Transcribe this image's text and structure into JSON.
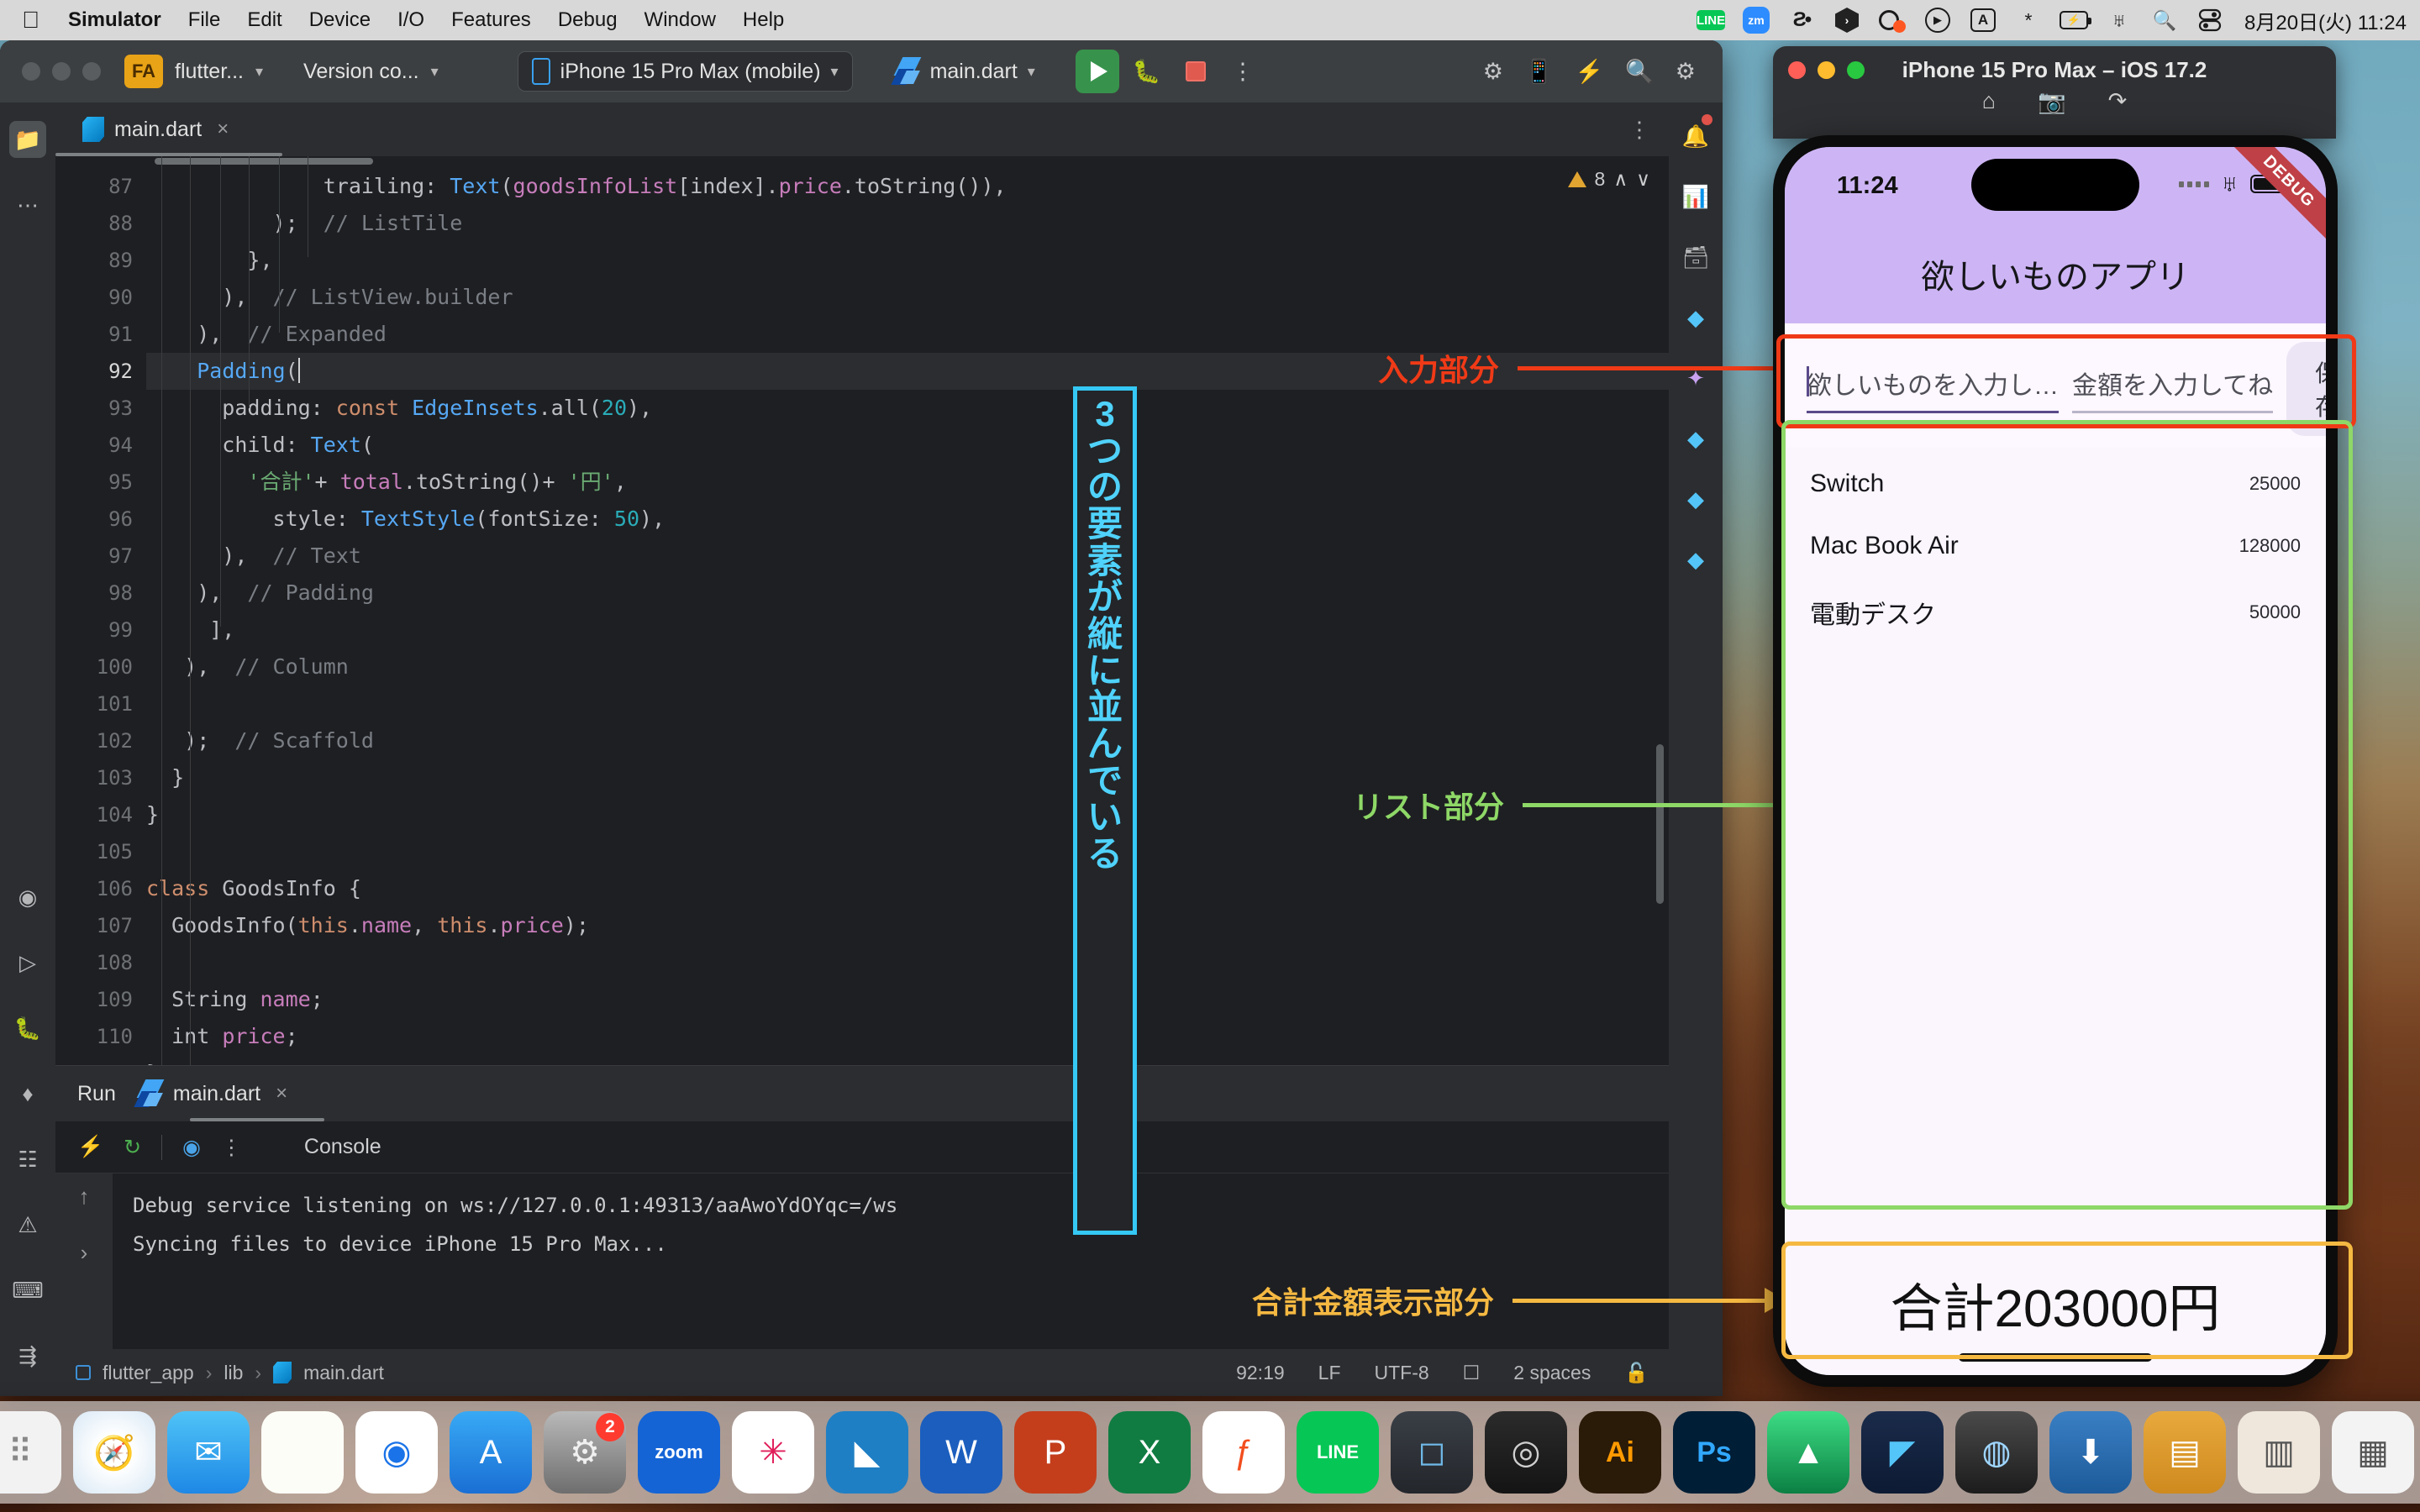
{
  "menubar": {
    "apple_icon": "apple-logo-icon",
    "items": [
      {
        "label": "Simulator",
        "bold": true
      },
      {
        "label": "File",
        "bold": false
      },
      {
        "label": "Edit",
        "bold": false
      },
      {
        "label": "Device",
        "bold": false
      },
      {
        "label": "I/O",
        "bold": false
      },
      {
        "label": "Features",
        "bold": false
      },
      {
        "label": "Debug",
        "bold": false
      },
      {
        "label": "Window",
        "bold": false
      },
      {
        "label": "Help",
        "bold": false
      }
    ],
    "status_icons": [
      "line-icon",
      "zoom-icon",
      "figma-icon",
      "hex-app-icon",
      "screen-recorder-icon",
      "play-circle-icon",
      "input-source-icon",
      "bluetooth-icon",
      "battery-charging-icon",
      "wifi-icon",
      "spotlight-search-icon",
      "control-center-icon"
    ],
    "input_source": "A",
    "clock": "8月20日(火)  11:24"
  },
  "ide": {
    "project_badge": "FA",
    "project_name": "flutter...",
    "vcs_label": "Version co...",
    "device_selector": "iPhone 15 Pro Max (mobile)",
    "run_config": "main.dart",
    "toolbar_icons": [
      "run-button",
      "debug-button",
      "stop-button",
      "more-options-icon",
      "flutter-inspector-icon",
      "device-preview-icon",
      "hot-reload-icon",
      "search-everywhere-icon",
      "settings-gear-icon"
    ],
    "left_rail_icons": [
      "project-folder-icon",
      "more-tools-icon",
      "dart-analysis-icon",
      "run-panel-icon",
      "debug-panel-icon",
      "flutter-outline-icon",
      "structure-icon",
      "problems-icon",
      "terminal-icon",
      "git-branch-icon"
    ],
    "right_rail_icons": [
      "notifications-icon",
      "flutter-performance-icon",
      "flutter-devtools-icon",
      "flutter-inspector-icon",
      "ai-assistant-icon",
      "flutter-widget-icon",
      "flutter-outline-icon",
      "flutter-logs-icon"
    ],
    "editor_tab": {
      "label": "main.dart",
      "icon": "dart-file-icon",
      "close": "×"
    },
    "warning_count": "8",
    "editor": {
      "current_line": 92,
      "lines": [
        {
          "n": 87,
          "tokens": [
            {
              "t": "              trailing: ",
              "c": "pl"
            },
            {
              "t": "Text",
              "c": "fn"
            },
            {
              "t": "(",
              "c": "pl"
            },
            {
              "t": "goodsInfoList",
              "c": "fl"
            },
            {
              "t": "[index].",
              "c": "pl"
            },
            {
              "t": "price",
              "c": "fl"
            },
            {
              "t": ".toString()),",
              "c": "pl"
            }
          ]
        },
        {
          "n": 88,
          "tokens": [
            {
              "t": "          );  ",
              "c": "pl"
            },
            {
              "t": "// ListTile",
              "c": "cm"
            }
          ]
        },
        {
          "n": 89,
          "tokens": [
            {
              "t": "        },",
              "c": "pl"
            }
          ]
        },
        {
          "n": 90,
          "tokens": [
            {
              "t": "      ),  ",
              "c": "pl"
            },
            {
              "t": "// ListView.builder",
              "c": "cm"
            }
          ]
        },
        {
          "n": 91,
          "tokens": [
            {
              "t": "    ),  ",
              "c": "pl"
            },
            {
              "t": "// Expanded",
              "c": "cm"
            }
          ]
        },
        {
          "n": 92,
          "tokens": [
            {
              "t": "    ",
              "c": "pl"
            },
            {
              "t": "Padding",
              "c": "ty"
            },
            {
              "t": "(",
              "c": "pl"
            }
          ]
        },
        {
          "n": 93,
          "tokens": [
            {
              "t": "      padding: ",
              "c": "pl"
            },
            {
              "t": "const",
              "c": "k"
            },
            {
              "t": " ",
              "c": "pl"
            },
            {
              "t": "EdgeInsets",
              "c": "ty"
            },
            {
              "t": ".all(",
              "c": "pl"
            },
            {
              "t": "20",
              "c": "nu"
            },
            {
              "t": "),",
              "c": "pl"
            }
          ]
        },
        {
          "n": 94,
          "tokens": [
            {
              "t": "      child: ",
              "c": "pl"
            },
            {
              "t": "Text",
              "c": "fn"
            },
            {
              "t": "(",
              "c": "pl"
            }
          ]
        },
        {
          "n": 95,
          "tokens": [
            {
              "t": "        ",
              "c": "pl"
            },
            {
              "t": "'合計'",
              "c": "st"
            },
            {
              "t": "+ ",
              "c": "pl"
            },
            {
              "t": "total",
              "c": "fl"
            },
            {
              "t": ".toString()+ ",
              "c": "pl"
            },
            {
              "t": "'円'",
              "c": "st"
            },
            {
              "t": ",",
              "c": "pl"
            }
          ]
        },
        {
          "n": 96,
          "tokens": [
            {
              "t": "          style: ",
              "c": "pl"
            },
            {
              "t": "TextStyle",
              "c": "ty"
            },
            {
              "t": "(fontSize: ",
              "c": "pl"
            },
            {
              "t": "50",
              "c": "nu"
            },
            {
              "t": "),",
              "c": "pl"
            }
          ]
        },
        {
          "n": 97,
          "tokens": [
            {
              "t": "      ),  ",
              "c": "pl"
            },
            {
              "t": "// Text",
              "c": "cm"
            }
          ]
        },
        {
          "n": 98,
          "tokens": [
            {
              "t": "    ),  ",
              "c": "pl"
            },
            {
              "t": "// Padding",
              "c": "cm"
            }
          ]
        },
        {
          "n": 99,
          "tokens": [
            {
              "t": "     ],",
              "c": "pl"
            }
          ]
        },
        {
          "n": 100,
          "tokens": [
            {
              "t": "   ),  ",
              "c": "pl"
            },
            {
              "t": "// Column",
              "c": "cm"
            }
          ]
        },
        {
          "n": 101,
          "tokens": [
            {
              "t": "",
              "c": "pl"
            }
          ]
        },
        {
          "n": 102,
          "tokens": [
            {
              "t": "   );  ",
              "c": "pl"
            },
            {
              "t": "// Scaffold",
              "c": "cm"
            }
          ]
        },
        {
          "n": 103,
          "tokens": [
            {
              "t": "  }",
              "c": "pl"
            }
          ]
        },
        {
          "n": 104,
          "tokens": [
            {
              "t": "}",
              "c": "pl"
            }
          ]
        },
        {
          "n": 105,
          "tokens": [
            {
              "t": "",
              "c": "pl"
            }
          ]
        },
        {
          "n": 106,
          "tokens": [
            {
              "t": "class",
              "c": "k"
            },
            {
              "t": " GoodsInfo {",
              "c": "pl"
            }
          ]
        },
        {
          "n": 107,
          "tokens": [
            {
              "t": "  GoodsInfo(",
              "c": "pl"
            },
            {
              "t": "this",
              "c": "k"
            },
            {
              "t": ".",
              "c": "pl"
            },
            {
              "t": "name",
              "c": "fl"
            },
            {
              "t": ", ",
              "c": "pl"
            },
            {
              "t": "this",
              "c": "k"
            },
            {
              "t": ".",
              "c": "pl"
            },
            {
              "t": "price",
              "c": "fl"
            },
            {
              "t": ");",
              "c": "pl"
            }
          ]
        },
        {
          "n": 108,
          "tokens": [
            {
              "t": "",
              "c": "pl"
            }
          ]
        },
        {
          "n": 109,
          "tokens": [
            {
              "t": "  String ",
              "c": "pl"
            },
            {
              "t": "name",
              "c": "fl"
            },
            {
              "t": ";",
              "c": "pl"
            }
          ]
        },
        {
          "n": 110,
          "tokens": [
            {
              "t": "  int ",
              "c": "pl"
            },
            {
              "t": "price",
              "c": "fl"
            },
            {
              "t": ";",
              "c": "pl"
            }
          ]
        },
        {
          "n": 111,
          "tokens": [
            {
              "t": "}",
              "c": "pl"
            }
          ]
        }
      ]
    },
    "run_panel": {
      "title": "Run",
      "tab_label": "main.dart",
      "tab_close": "×",
      "tool_icons": [
        "rerun-icon",
        "hot-restart-icon",
        "dart-devtools-icon",
        "more-icon"
      ],
      "console_label": "Console",
      "layout_icon": "layout-panel-icon",
      "scroll_up_icon": "↑",
      "scroll_down_icon": "›",
      "output": [
        "Debug service listening on ws://127.0.0.1:49313/aaAwoYdOYqc=/ws",
        "Syncing files to device iPhone 15 Pro Max..."
      ]
    },
    "statusbar": {
      "breadcrumb": [
        "flutter_app",
        "lib",
        "main.dart"
      ],
      "separator": "›",
      "caret_pos": "92:19",
      "line_sep": "LF",
      "encoding": "UTF-8",
      "indent": "2 spaces",
      "readonly_icon": "lock-icon",
      "inspection_icon": "inspection-icon"
    }
  },
  "annotations": {
    "input": {
      "label": "入力部分",
      "color": "#f03a17"
    },
    "list": {
      "label": "リスト部分",
      "color": "#8ed867"
    },
    "total": {
      "label": "合計金額表示部分",
      "color": "#f5b942"
    },
    "vertical_note": {
      "chars": [
        "3",
        "つ",
        "の",
        "要",
        "素",
        "が",
        "縦",
        "に",
        "並",
        "ん",
        "で",
        "い",
        "る"
      ],
      "text": "3つの要素が縦に並んでいる",
      "color": "#35c8f5"
    }
  },
  "simulator": {
    "window_title": "iPhone 15 Pro Max – iOS 17.2",
    "traffic_lights": [
      "close-button",
      "minimize-button",
      "maximize-button"
    ],
    "tool_icons": [
      "home-icon",
      "screenshot-icon",
      "rotate-icon"
    ],
    "ios": {
      "status_time": "11:24",
      "status_icons": [
        "cellular-signal-icon",
        "wifi-icon",
        "battery-icon"
      ],
      "debug_ribbon": "DEBUG"
    },
    "app": {
      "title": "欲しいものアプリ",
      "name_placeholder": "欲しいものを入力し…",
      "price_placeholder": "金額を入力してね",
      "save_label": "保存",
      "items": [
        {
          "name": "Switch",
          "price": "25000"
        },
        {
          "name": "Mac Book Air",
          "price": "128000"
        },
        {
          "name": "電動デスク",
          "price": "50000"
        }
      ],
      "total_text": "合計203000円"
    }
  },
  "dock": {
    "items": [
      {
        "name": "finder-icon",
        "glyph": "☺",
        "bg": "linear-gradient(90deg,#1e9bf0 50%,#dfe9f5 50%)",
        "color": "#0a3d6b",
        "running": true
      },
      {
        "name": "launchpad-icon",
        "glyph": "⠿",
        "bg": "#f2f2f2",
        "color": "#888",
        "running": false
      },
      {
        "name": "safari-icon",
        "glyph": "🧭",
        "bg": "radial-gradient(circle,#fff 30%,#d8e8f5 100%)",
        "color": "#1574c8",
        "running": false
      },
      {
        "name": "mail-icon",
        "glyph": "✉",
        "bg": "linear-gradient(180deg,#4fc3f7,#1e88e5)",
        "color": "#fff",
        "running": false
      },
      {
        "name": "notes-icon",
        "glyph": "",
        "bg": "#fdfdf7",
        "color": "#c9a227",
        "running": true
      },
      {
        "name": "chrome-icon",
        "glyph": "◉",
        "bg": "#fff",
        "color": "#1a73e8",
        "running": true
      },
      {
        "name": "app-store-icon",
        "glyph": "A",
        "bg": "linear-gradient(180deg,#38a9f5,#1a6fd4)",
        "color": "#fff",
        "running": false
      },
      {
        "name": "system-settings-icon",
        "glyph": "⚙",
        "bg": "linear-gradient(180deg,#b9b9b9,#6e6e6e)",
        "color": "#f0f0f0",
        "badge": "2",
        "running": false
      },
      {
        "name": "zoom-icon",
        "glyph": "zoom",
        "bg": "#1464d6",
        "color": "#fff",
        "running": true
      },
      {
        "name": "slack-icon",
        "glyph": "✳",
        "bg": "#fff",
        "color": "#e01e5a",
        "running": true
      },
      {
        "name": "vscode-icon",
        "glyph": "◣",
        "bg": "#1f7fc4",
        "color": "#fff",
        "running": false
      },
      {
        "name": "word-icon",
        "glyph": "W",
        "bg": "#1b5ebe",
        "color": "#fff",
        "running": false
      },
      {
        "name": "powerpoint-icon",
        "glyph": "P",
        "bg": "#c43e1c",
        "color": "#fff",
        "running": false
      },
      {
        "name": "excel-icon",
        "glyph": "X",
        "bg": "#107c41",
        "color": "#fff",
        "running": false
      },
      {
        "name": "figma-icon",
        "glyph": "ƒ",
        "bg": "#fff",
        "color": "#f24e1e",
        "running": false
      },
      {
        "name": "line-icon",
        "glyph": "LINE",
        "bg": "#06c755",
        "color": "#fff",
        "running": true
      },
      {
        "name": "keynote-icon",
        "glyph": "◻",
        "bg": "linear-gradient(180deg,#3a3f46,#23262b)",
        "color": "#6fb9e8",
        "running": false
      },
      {
        "name": "davinci-resolve-icon",
        "glyph": "◎",
        "bg": "linear-gradient(180deg,#2b2b2b,#141414)",
        "color": "#d0d0d0",
        "running": false
      },
      {
        "name": "illustrator-icon",
        "glyph": "Ai",
        "bg": "#2a1a08",
        "color": "#ff9a00",
        "running": false
      },
      {
        "name": "photoshop-icon",
        "glyph": "Ps",
        "bg": "#001e36",
        "color": "#31a8ff",
        "running": false
      },
      {
        "name": "android-studio-icon",
        "glyph": "▲",
        "bg": "linear-gradient(180deg,#3ddc84,#0b8043)",
        "color": "#fff",
        "running": true
      },
      {
        "name": "flutter-icon",
        "glyph": "◤",
        "bg": "linear-gradient(180deg,#1a2b4a,#0d1a33)",
        "color": "#54c5f8",
        "running": true
      },
      {
        "name": "finder-search-icon",
        "glyph": "◍",
        "bg": "linear-gradient(180deg,#4a4a4a,#1c1c1c)",
        "color": "#9fd6ff",
        "running": false
      },
      {
        "name": "downloads-stack-icon",
        "glyph": "⬇",
        "bg": "linear-gradient(180deg,#3a7fc4,#1d5b9a)",
        "color": "#fff",
        "running": false
      },
      {
        "name": "documents-folder-icon",
        "glyph": "▤",
        "bg": "linear-gradient(180deg,#e8a93c,#cf8a1e)",
        "color": "#fff",
        "running": false
      },
      {
        "name": "recent-item-1-icon",
        "glyph": "▥",
        "bg": "#efe7dc",
        "color": "#555",
        "running": false
      },
      {
        "name": "recent-item-2-icon",
        "glyph": "▦",
        "bg": "#f3f3f3",
        "color": "#555",
        "running": false
      },
      {
        "name": "trash-icon",
        "glyph": "🗑",
        "bg": "rgba(240,240,240,.8)",
        "color": "#6b6b6b",
        "running": false
      }
    ]
  }
}
